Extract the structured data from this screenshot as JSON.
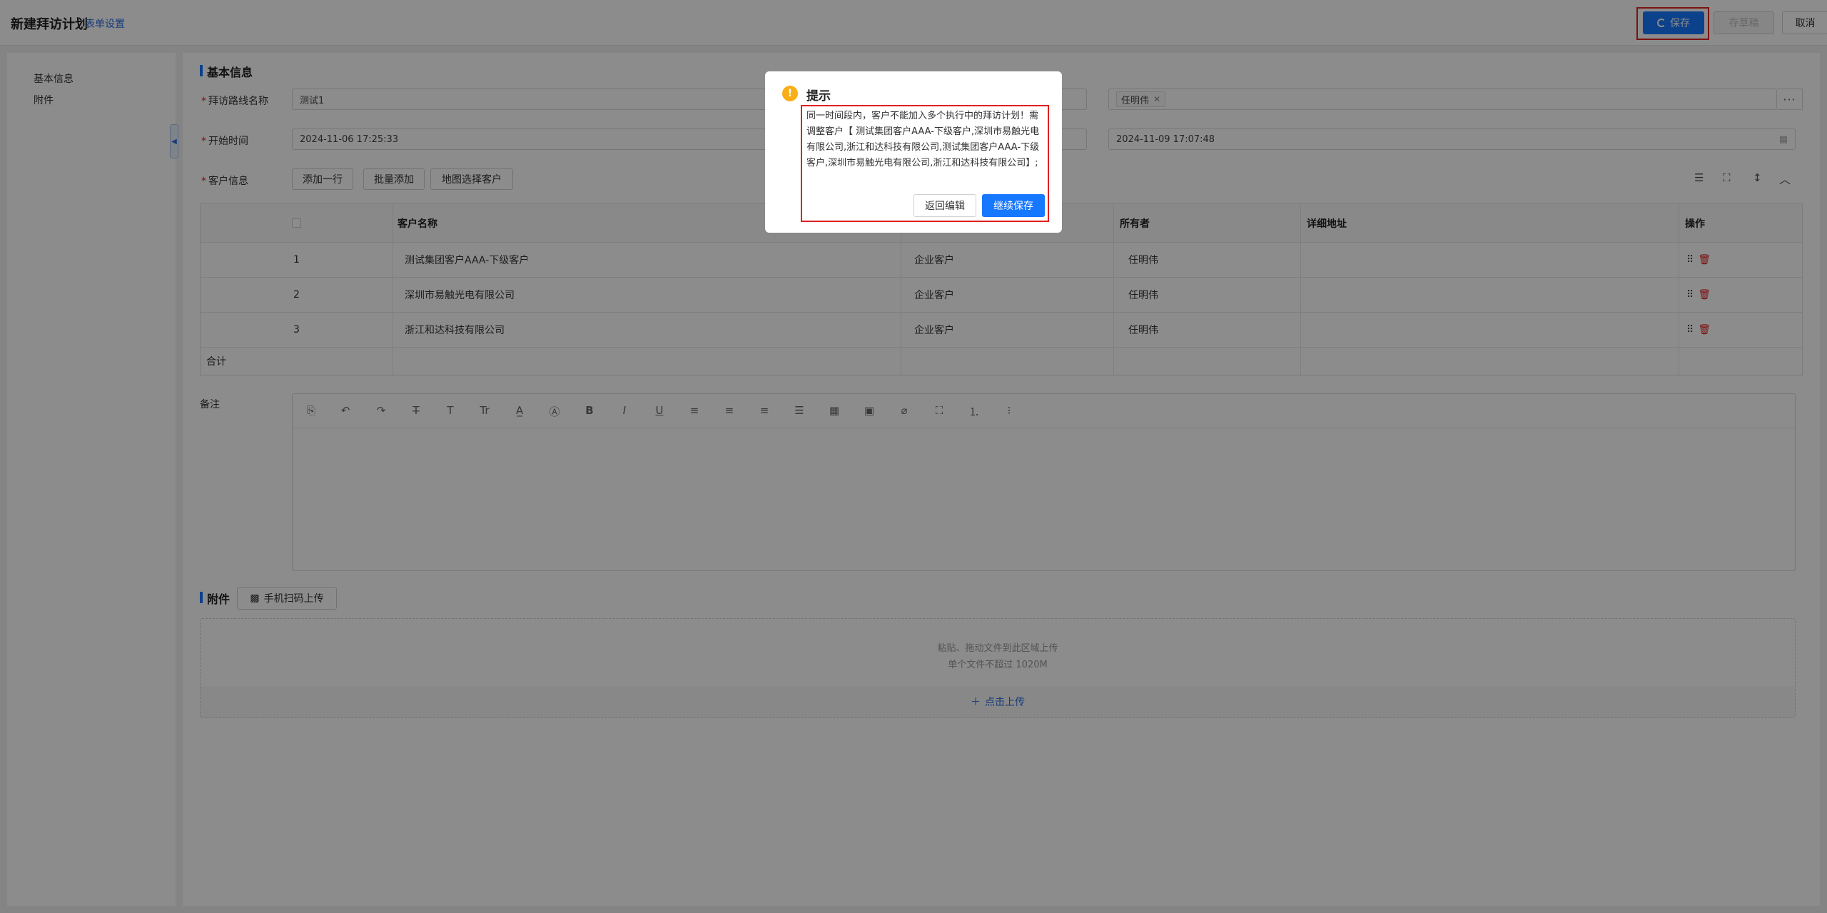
{
  "header": {
    "title": "新建拜访计划",
    "form_settings": "表单设置",
    "save_label": "保存",
    "draft_label": "存草稿",
    "cancel_label": "取消"
  },
  "sidebar": {
    "items": [
      {
        "label": "基本信息"
      },
      {
        "label": "附件"
      }
    ]
  },
  "basic_info": {
    "section_title": "基本信息",
    "route_label": "拜访路线名称",
    "route_value": "测试1",
    "owner_tag": "任明伟",
    "start_label": "开始时间",
    "start_value": "2024-11-06 17:25:33",
    "end_value": "2024-11-09 17:07:48",
    "customer_label": "客户信息",
    "add_row": "添加一行",
    "batch_add": "批量添加",
    "map_select": "地图选择客户"
  },
  "table": {
    "columns": [
      "客户名称",
      "所有者",
      "详细地址",
      "操作"
    ],
    "rows": [
      {
        "no": "1",
        "name": "测试集团客户AAA-下级客户",
        "type": "企业客户",
        "owner": "任明伟",
        "address": ""
      },
      {
        "no": "2",
        "name": "深圳市易触光电有限公司",
        "type": "企业客户",
        "owner": "任明伟",
        "address": ""
      },
      {
        "no": "3",
        "name": "浙江和达科技有限公司",
        "type": "企业客户",
        "owner": "任明伟",
        "address": ""
      }
    ],
    "total_label": "合计"
  },
  "remarks": {
    "label": "备注"
  },
  "attachments": {
    "section_title": "附件",
    "qr_upload": "手机扫码上传",
    "hint1": "粘贴、拖动文件到此区域上传",
    "hint2": "单个文件不超过 1020M",
    "upload_link": "点击上传"
  },
  "modal": {
    "title": "提示",
    "message": "同一时间段内，客户不能加入多个执行中的拜访计划！需调整客户【 测试集团客户AAA-下级客户,深圳市易触光电有限公司,浙江和达科技有限公司,测试集团客户AAA-下级客户,深圳市易触光电有限公司,浙江和达科技有限公司】;",
    "back_label": "返回编辑",
    "continue_label": "继续保存"
  },
  "colors": {
    "primary": "#1677ff",
    "danger": "#e02020",
    "warning": "#faad14"
  }
}
